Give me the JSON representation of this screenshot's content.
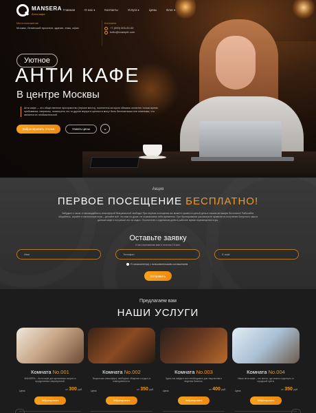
{
  "header": {
    "logo_name": "MANSERA",
    "logo_sub": "Анти кафе",
    "nav": [
      {
        "label": "Главная",
        "dropdown": false
      },
      {
        "label": "О нас",
        "dropdown": true
      },
      {
        "label": "Контакты",
        "dropdown": false
      },
      {
        "label": "Услуги",
        "dropdown": true
      },
      {
        "label": "Цены",
        "dropdown": false
      },
      {
        "label": "Блог",
        "dropdown": true
      }
    ],
    "location_heading": "Местоположение",
    "location_text": "Москва, Ленинский проспект, здание, этаж, офис",
    "contacts_heading": "Контакты",
    "phone": "+7 (000) 000-00-00",
    "email": "hello@example.com"
  },
  "hero": {
    "tag": "Уютное",
    "title": "АНТИ КАФЕ",
    "subtitle": "В центре Москвы",
    "description": "Анти кафе — это общественное пространство (термин места), посетитель которого обязаны оплатить только время пребывания, например, посмотреть что то другое внутри в ценности могут быть бесплатными или платными, что является их необязательной.",
    "primary_button": "Забронировать столик",
    "secondary_button": "Узнать цены",
    "scroll_icon": "chevron-down-icon"
  },
  "promo": {
    "label": "Акция",
    "title_main": "ПЕРВОЕ ПОСЕЩЕНИЕ ",
    "title_accent": "БЕСПЛАТНО!",
    "text": "Забудьте о часах и наслаждайтесь атмосферой безграничной свободы! При первом посещении вы можете провести целый день в нашем антикафе бесплатно! Работайте, общайтесь, играйте в настольные игры – делайте всё, что вам по душе, не ограничивая себя временем. При бронировании рассмотрите правила на получение бонусного часа в данном кафе и потратьте его на отдых. Посетители с отдельным днём в рабочее время перемещения игры.",
    "form_title": "Оставьте заявку",
    "form_sub": "И мы перезвоним вам в течении 15 мин.",
    "fields": [
      {
        "placeholder": "Имя"
      },
      {
        "placeholder": "Телефон"
      },
      {
        "placeholder": "E-mail"
      }
    ],
    "consent": "Я ознакомлен(а) с пользовательским соглашением",
    "submit": "Отправить"
  },
  "services": {
    "label": "Предлагаем вам",
    "title": "НАШИ УСЛУГИ",
    "price_label": "Цена",
    "items": [
      {
        "name": "Комната ",
        "number": "No.001",
        "desc": "MANSERA – Анти кафе для креативных встреч и продуктивных мероприятий.",
        "price_prefix": "от",
        "price": "300",
        "unit": "руб.",
        "button": "Забронировать"
      },
      {
        "name": "Комната ",
        "number": "No.002",
        "desc": "Творческая атмосфера, свободное общение и отдых от повседневности.",
        "price_prefix": "от",
        "price": "350",
        "unit": "руб.",
        "button": "Забронировать"
      },
      {
        "name": "Комната ",
        "number": "No.003",
        "desc": "Здесь вы найдете все необходимое для творчества и ведения бизнеса.",
        "price_prefix": "от",
        "price": "400",
        "unit": "руб.",
        "button": "Забронировать"
      },
      {
        "name": "Комната ",
        "number": "No.004",
        "desc": "Наше анти кафе – это место, где можно отдохнуть от городской суеты.",
        "price_prefix": "от",
        "price": "350",
        "unit": "руб.",
        "button": "Забронировать"
      }
    ]
  }
}
